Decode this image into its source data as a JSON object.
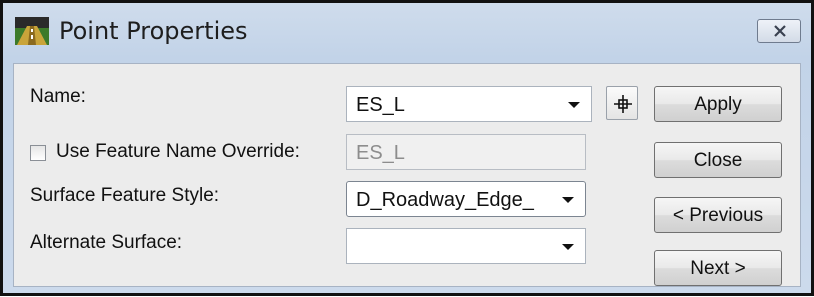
{
  "window": {
    "title": "Point Properties",
    "app_icon": "road-icon",
    "close_icon": "close-icon"
  },
  "form": {
    "name": {
      "label": "Name:",
      "value": "ES_L"
    },
    "feature_name_override": {
      "label": "Use Feature Name Override:",
      "checked": false,
      "value": "ES_L"
    },
    "surface_feature_style": {
      "label": "Surface Feature Style:",
      "value": "D_Roadway_Edge_"
    },
    "alternate_surface": {
      "label": "Alternate Surface:",
      "value": ""
    },
    "pick_point_icon": "crosshair-icon"
  },
  "buttons": {
    "apply": "Apply",
    "close": "Close",
    "previous": "< Previous",
    "next": "Next >"
  }
}
